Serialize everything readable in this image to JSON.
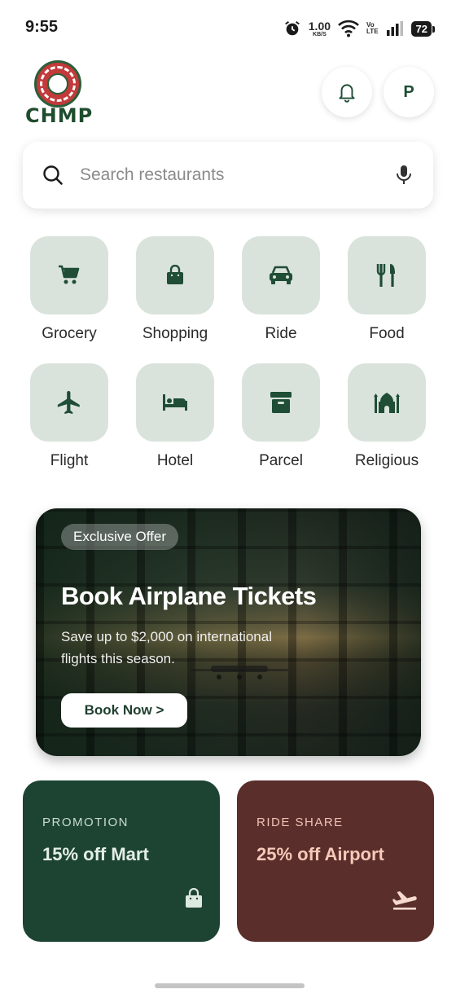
{
  "status_bar": {
    "time": "9:55",
    "net_speed": "1.00",
    "net_unit": "KB/S",
    "volte_top": "Vo",
    "volte_bottom": "LTE",
    "battery": "72"
  },
  "header": {
    "logo_text": "CHMP",
    "avatar_initial": "P"
  },
  "search": {
    "placeholder": "Search restaurants"
  },
  "categories": [
    {
      "label": "Grocery",
      "icon": "cart-icon"
    },
    {
      "label": "Shopping",
      "icon": "shopping-bag-icon"
    },
    {
      "label": "Ride",
      "icon": "car-icon"
    },
    {
      "label": "Food",
      "icon": "fork-knife-icon"
    },
    {
      "label": "Flight",
      "icon": "airplane-icon"
    },
    {
      "label": "Hotel",
      "icon": "bed-icon"
    },
    {
      "label": "Parcel",
      "icon": "archive-box-icon"
    },
    {
      "label": "Religious",
      "icon": "mosque-icon"
    }
  ],
  "banner": {
    "tag": "Exclusive Offer",
    "title": "Book Airplane Tickets",
    "subtitle": "Save up to $2,000 on international flights this season.",
    "button": "Book Now >"
  },
  "promos": [
    {
      "kicker": "PROMOTION",
      "title": "15% off Mart",
      "icon": "shopping-bag-icon"
    },
    {
      "kicker": "RIDE SHARE",
      "title": "25% off Airport",
      "icon": "flight-takeoff-icon"
    }
  ],
  "colors": {
    "accent": "#1f4d35",
    "tile_bg": "#d9e3dc",
    "promo_green": "#1d4433",
    "promo_maroon": "#5a2e2b"
  }
}
